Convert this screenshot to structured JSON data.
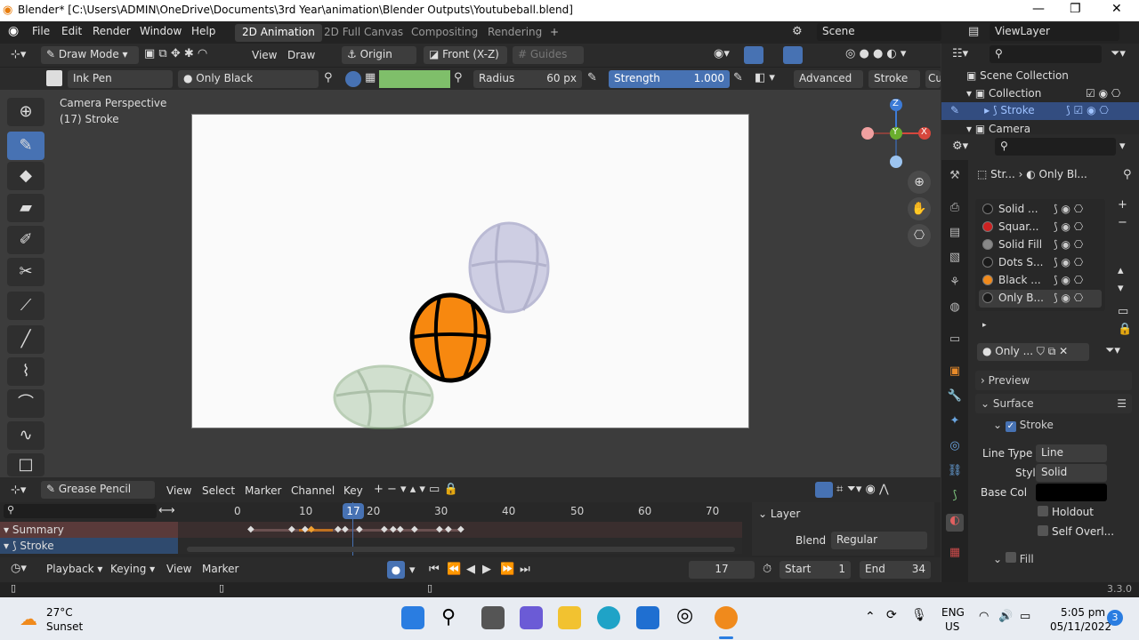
{
  "titlebar": {
    "title": "Blender* [C:\\Users\\ADMIN\\OneDrive\\Documents\\3rd Year\\animation\\Blender Outputs\\Youtubeball.blend]",
    "minimize": "—",
    "maximize": "❐",
    "close": "✕"
  },
  "menu": {
    "items": [
      "File",
      "Edit",
      "Render",
      "Window",
      "Help"
    ]
  },
  "workspaces": {
    "tabs": [
      "2D Animation",
      "2D Full Canvas",
      "Compositing",
      "Rendering"
    ],
    "active": "2D Animation",
    "add": "+"
  },
  "scene": {
    "label": "Scene",
    "view_layer": "ViewLayer"
  },
  "header": {
    "mode": "Draw Mode",
    "view": "View",
    "draw": "Draw",
    "origin": "Origin",
    "projection": "Front (X-Z)",
    "guides": "Guides"
  },
  "toolsettings": {
    "brush": "Ink Pen",
    "material": "Only Black",
    "radius_label": "Radius",
    "radius_value": "60 px",
    "strength_label": "Strength",
    "strength_value": "1.000",
    "advanced": "Advanced",
    "stroke": "Stroke",
    "cut": "Cu",
    "color_swatch": "#7fbf6a"
  },
  "viewport": {
    "info1": "Camera Perspective",
    "info2": "(17) Stroke",
    "axis_z": "Z",
    "axis_y": "Y",
    "axis_x": "X"
  },
  "outliner": {
    "search_placeholder": "",
    "rows": [
      "Scene Collection",
      "Collection",
      "Stroke",
      "Camera"
    ]
  },
  "properties": {
    "breadcrumb_obj": "Str...",
    "breadcrumb_mat": "Only Bl...",
    "materials": [
      {
        "name": "Solid ...",
        "color": "#1a1a1a"
      },
      {
        "name": "Squar...",
        "color": "#cc2222"
      },
      {
        "name": "Solid Fill",
        "color": "#888888"
      },
      {
        "name": "Dots S...",
        "color": "#1a1a1a"
      },
      {
        "name": "Black ...",
        "color": "#f08a1c"
      },
      {
        "name": "Only B...",
        "color": "#1a1a1a"
      }
    ],
    "slot_name": "Only ...",
    "preview": "Preview",
    "surface": "Surface",
    "stroke": "Stroke",
    "line_type_label": "Line Type",
    "line_type": "Line",
    "style_label": "Style",
    "style": "Solid",
    "base_col_label": "Base Col",
    "holdout": "Holdout",
    "self_overlap": "Self Overl...",
    "fill": "Fill"
  },
  "timeline": {
    "editor": "Grease Pencil",
    "menus": [
      "View",
      "Select",
      "Marker",
      "Channel",
      "Key"
    ],
    "frames": [
      "0",
      "10",
      "17",
      "20",
      "30",
      "40",
      "50",
      "60",
      "70"
    ],
    "current_frame": 17,
    "channels": [
      "Summary",
      "Stroke"
    ],
    "layer_panel": "Layer",
    "blend_label": "Blend",
    "blend_value": "Regular",
    "playback": "Playback",
    "keying": "Keying",
    "view": "View",
    "marker": "Marker",
    "frame_field": "17",
    "start_label": "Start",
    "start_value": "1",
    "end_label": "End",
    "end_value": "34"
  },
  "status": {
    "version": "3.3.0"
  },
  "taskbar": {
    "weather_temp": "27°C",
    "weather_desc": "Sunset",
    "lang1": "ENG",
    "lang2": "US",
    "time": "5:05 pm",
    "date": "05/11/2022",
    "badge": "3"
  }
}
